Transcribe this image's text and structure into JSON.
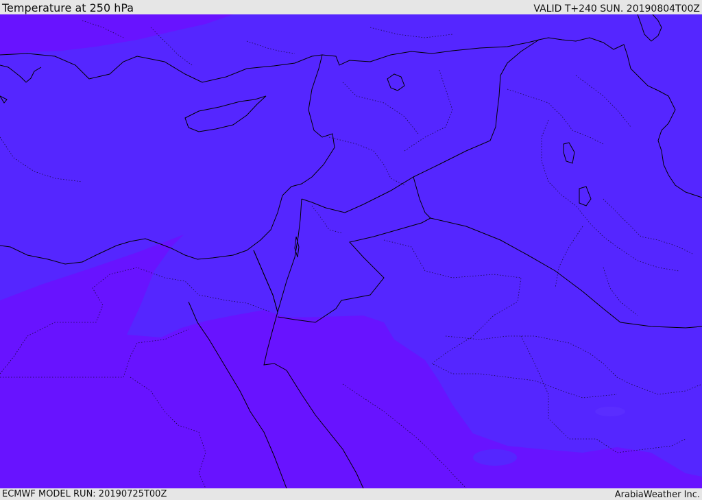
{
  "header": {
    "title": "Temperature at 250 hPa",
    "valid_time": "VALID T+240 SUN. 20190804T00Z"
  },
  "footer": {
    "model_run": "ECMWF MODEL RUN: 20190725T00Z",
    "credit": "ArabiaWeather Inc."
  },
  "map": {
    "colors": {
      "warm_band": "#5526ff",
      "cold_band": "#6813ff",
      "coastline": "#000000",
      "borders": "#000000"
    }
  }
}
